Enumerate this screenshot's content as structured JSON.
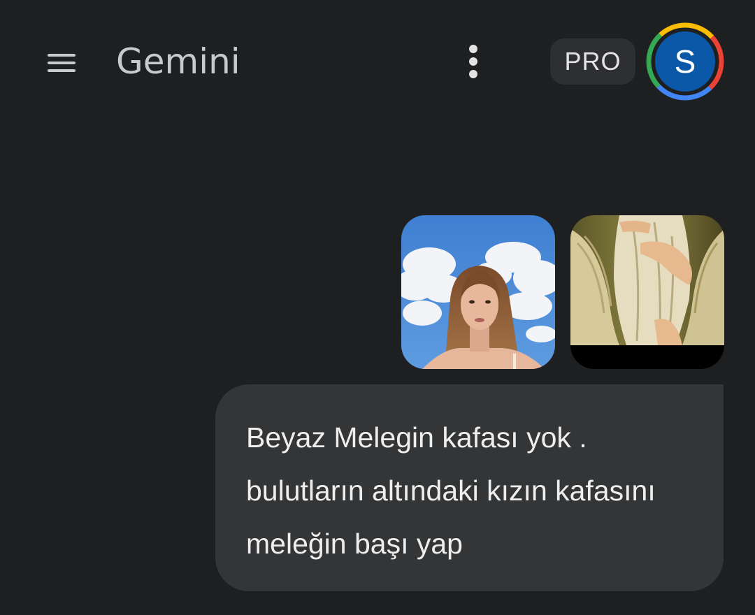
{
  "header": {
    "menu_icon": "hamburger-menu-icon",
    "title": "Gemini",
    "more_icon": "more-vert-icon",
    "plan_badge": "PRO",
    "avatar_initial": "S",
    "avatar_color": "#0b57a8"
  },
  "conversation": {
    "attachments": [
      {
        "icon": "photo-woman-under-clouds"
      },
      {
        "icon": "painting-white-angel"
      }
    ],
    "user_message": "Beyaz Melegin kafası yok .\nbulutların altındaki kızın kafasını\nmeleğin başı yap"
  },
  "colors": {
    "background": "#1e1f21",
    "bubble": "#333537",
    "badge": "#2e2f32"
  }
}
